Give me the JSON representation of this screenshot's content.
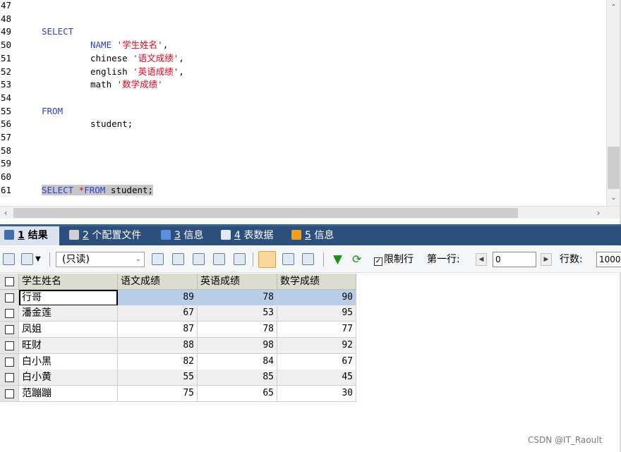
{
  "editor": {
    "lines": [
      {
        "n": "47",
        "parts": []
      },
      {
        "n": "48",
        "parts": []
      },
      {
        "n": "49",
        "parts": [
          {
            "t": "SELECT",
            "c": "kw",
            "x": 0
          }
        ]
      },
      {
        "n": "50",
        "parts": [
          {
            "t": "NAME",
            "c": "kw",
            "x": 1
          },
          {
            "t": " ",
            "c": ""
          },
          {
            "t": "'学生姓名'",
            "c": "str"
          },
          {
            "t": ",",
            "c": ""
          }
        ]
      },
      {
        "n": "51",
        "parts": [
          {
            "t": "chinese ",
            "c": "",
            "x": 1
          },
          {
            "t": "'语文成绩'",
            "c": "str"
          },
          {
            "t": ",",
            "c": ""
          }
        ]
      },
      {
        "n": "52",
        "parts": [
          {
            "t": "english ",
            "c": "",
            "x": 1
          },
          {
            "t": "'英语成绩'",
            "c": "str"
          },
          {
            "t": ",",
            "c": ""
          }
        ]
      },
      {
        "n": "53",
        "parts": [
          {
            "t": "math ",
            "c": "",
            "x": 1
          },
          {
            "t": "'数学成绩'",
            "c": "str"
          }
        ]
      },
      {
        "n": "54",
        "parts": []
      },
      {
        "n": "55",
        "parts": [
          {
            "t": "FROM",
            "c": "kw",
            "x": 0
          }
        ]
      },
      {
        "n": "56",
        "parts": [
          {
            "t": "student;",
            "c": "",
            "x": 1
          }
        ]
      },
      {
        "n": "57",
        "parts": []
      },
      {
        "n": "58",
        "parts": []
      },
      {
        "n": "59",
        "parts": []
      },
      {
        "n": "60",
        "parts": []
      },
      {
        "n": "61",
        "parts": [
          {
            "t": "SELECT",
            "c": "kw sel",
            "x": 0
          },
          {
            "t": " ",
            "c": "sel"
          },
          {
            "t": "*",
            "c": "str sel"
          },
          {
            "t": "FROM",
            "c": "kw sel"
          },
          {
            "t": " student;",
            "c": "sel"
          }
        ]
      }
    ]
  },
  "tabs": [
    {
      "num": "1",
      "label": "结果",
      "active": true,
      "icon_color": "#3d6ea8"
    },
    {
      "num": "2",
      "label": "个配置文件",
      "active": false,
      "icon_color": "#d0d0d0"
    },
    {
      "num": "3",
      "label": "信息",
      "active": false,
      "icon_color": "#5a8fe0"
    },
    {
      "num": "4",
      "label": "表数据",
      "active": false,
      "icon_color": "#e0e8f0"
    },
    {
      "num": "5",
      "label": "信息",
      "active": false,
      "icon_color": "#f0a020"
    }
  ],
  "toolbar": {
    "mode_select": "(只读)",
    "limit_rows_label": "限制行",
    "first_row_label": "第一行:",
    "first_row_value": "0",
    "row_count_label": "行数:",
    "row_count_value": "1000"
  },
  "grid": {
    "headers": [
      "学生姓名",
      "语文成绩",
      "英语成绩",
      "数学成绩"
    ],
    "rows": [
      [
        "行哥",
        "89",
        "78",
        "90"
      ],
      [
        "潘金莲",
        "67",
        "53",
        "95"
      ],
      [
        "凤姐",
        "87",
        "78",
        "77"
      ],
      [
        "旺财",
        "88",
        "98",
        "92"
      ],
      [
        "白小黑",
        "82",
        "84",
        "67"
      ],
      [
        "白小黄",
        "55",
        "85",
        "45"
      ],
      [
        "范蹦蹦",
        "75",
        "65",
        "30"
      ]
    ]
  },
  "watermark": "CSDN @IT_Raoult"
}
